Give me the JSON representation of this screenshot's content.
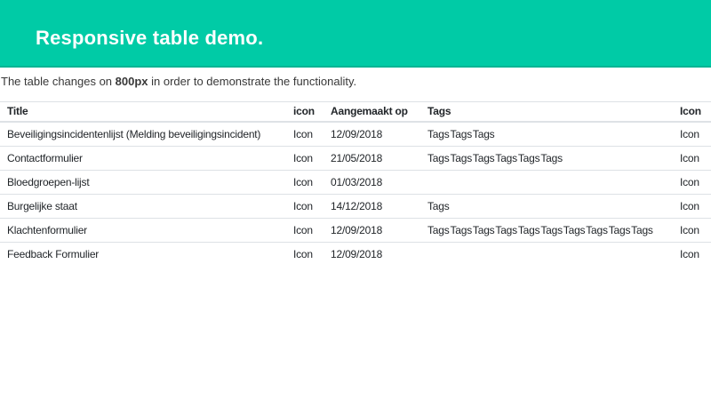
{
  "banner": {
    "title": "Responsive table demo."
  },
  "intro": {
    "prefix": "The table changes on ",
    "bold": "800px",
    "suffix": " in order to demonstrate the functionality."
  },
  "table": {
    "columns": [
      {
        "key": "title",
        "label": "Title"
      },
      {
        "key": "icon",
        "label": "icon"
      },
      {
        "key": "created",
        "label": "Aangemaakt op"
      },
      {
        "key": "tags",
        "label": "Tags"
      },
      {
        "key": "icon2",
        "label": "Icon"
      }
    ],
    "rows": [
      {
        "title": "Beveiligingsincidentenlijst (Melding beveiligingsincident)",
        "icon": "Icon",
        "created": "12/09/2018",
        "tags": "Tags Tags Tags",
        "icon2": "Icon"
      },
      {
        "title": "Contactformulier",
        "icon": "Icon",
        "created": "21/05/2018",
        "tags": "Tags Tags Tags Tags Tags Tags",
        "icon2": "Icon"
      },
      {
        "title": "Bloedgroepen-lijst",
        "icon": "Icon",
        "created": "01/03/2018",
        "tags": "",
        "icon2": "Icon"
      },
      {
        "title": "Burgelijke staat",
        "icon": "Icon",
        "created": "14/12/2018",
        "tags": "Tags",
        "icon2": "Icon"
      },
      {
        "title": "Klachtenformulier",
        "icon": "Icon",
        "created": "12/09/2018",
        "tags": "Tags Tags Tags Tags Tags Tags Tags Tags Tags Tags",
        "icon2": "Icon"
      },
      {
        "title": "Feedback Formulier",
        "icon": "Icon",
        "created": "12/09/2018",
        "tags": "",
        "icon2": "Icon"
      }
    ]
  },
  "colors": {
    "banner_bg": "#00cba6",
    "banner_edge": "#00b494",
    "table_border": "#dee2e6",
    "table_text": "#212529",
    "intro_text": "#383838"
  }
}
